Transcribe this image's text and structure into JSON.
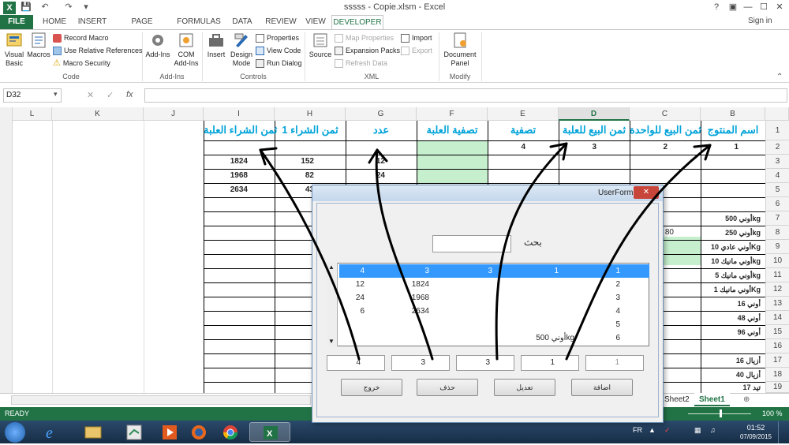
{
  "window": {
    "title": "sssss - Copie.xlsm - Excel",
    "controls": [
      "?",
      "▣",
      "—",
      "☐",
      "✕"
    ],
    "sign_in": "Sign in"
  },
  "ribbon_tabs": [
    "FILE",
    "HOME",
    "INSERT",
    "PAGE LAYOUT",
    "FORMULAS",
    "DATA",
    "REVIEW",
    "VIEW",
    "DEVELOPER"
  ],
  "ribbon": {
    "code": {
      "visual_basic": "Visual Basic",
      "macros": "Macros",
      "record_macro": "Record Macro",
      "use_relative": "Use Relative References",
      "macro_security": "Macro Security",
      "group_label": "Code"
    },
    "addins": {
      "addins": "Add-Ins",
      "com_addins": "COM Add-Ins",
      "group_label": "Add-Ins"
    },
    "controls": {
      "insert": "Insert",
      "design_mode": "Design Mode",
      "properties": "Properties",
      "view_code": "View Code",
      "run_dialog": "Run Dialog",
      "group_label": "Controls"
    },
    "xml": {
      "source": "Source",
      "map_properties": "Map Properties",
      "expansion_packs": "Expansion Packs",
      "refresh_data": "Refresh Data",
      "import": "Import",
      "export": "Export",
      "group_label": "XML"
    },
    "modify": {
      "document_panel": "Document Panel",
      "group_label": "Modify"
    }
  },
  "formula_bar": {
    "name_box": "D32",
    "fx": "fx",
    "cancel": "✕",
    "enter": "✓",
    "value": ""
  },
  "columns": [
    "L",
    "K",
    "J",
    "I",
    "H",
    "G",
    "F",
    "E",
    "D",
    "C",
    "B"
  ],
  "rows": [
    "1",
    "2",
    "3",
    "4",
    "5",
    "6",
    "7",
    "8",
    "9",
    "10",
    "11",
    "12",
    "13",
    "14",
    "15",
    "16",
    "17",
    "18",
    "19"
  ],
  "sheet": {
    "headers": {
      "B": "اسم المنتوج",
      "C": "ثمن البيع للواحدة",
      "D": "ثمن البيع للعلبة",
      "E": "تصفية",
      "F": "تصفية العلبة",
      "G": "عدد",
      "H": "ثمن الشراء 1",
      "I": "ثمن الشراء العلبة"
    },
    "row2": {
      "B": "1",
      "C": "2",
      "D": "3",
      "E": "4"
    },
    "row3": {
      "I": "1824",
      "H": "152",
      "G": "12"
    },
    "row4": {
      "I": "1968",
      "H": "82",
      "G": "24"
    },
    "row5": {
      "I": "2634",
      "H": "43"
    },
    "products": [
      "أوني 500kg",
      "أوني 250kg",
      "أوني عادي 10Kg",
      "أوني مانيك 10kg",
      "أوني مانيك 5kg",
      "أوني مانيك 1Kg",
      "أوني 16",
      "أوني 48",
      "أوني 96",
      "",
      "أزيال 16",
      "أزيال 40",
      "تيد 17"
    ],
    "c8_partial": "80"
  },
  "sheet_tabs": {
    "sheet2": "Sheet2",
    "sheet1": "Sheet1",
    "add": "⊕"
  },
  "status": {
    "ready": "READY",
    "zoom": "100 %"
  },
  "taskbar": {
    "lang": "FR",
    "time": "01:52",
    "date": "07/09/2015"
  },
  "userform": {
    "title": "UserForm1",
    "close": "✕",
    "search_label": "بحث",
    "search_value": "",
    "list_rows": [
      {
        "c1": "4",
        "c2": "3",
        "c3": "3",
        "c4": "1",
        "c5": "1",
        "selected": true
      },
      {
        "c1": "12",
        "c2": "1824",
        "c3": "",
        "c4": "",
        "c5": "2",
        "selected": false
      },
      {
        "c1": "24",
        "c2": "1968",
        "c3": "",
        "c4": "",
        "c5": "3",
        "selected": false
      },
      {
        "c1": "6",
        "c2": "2634",
        "c3": "",
        "c4": "",
        "c5": "4",
        "selected": false
      },
      {
        "c1": "",
        "c2": "",
        "c3": "",
        "c4": "",
        "c5": "5",
        "selected": false
      },
      {
        "c1": "",
        "c2": "",
        "c3": "",
        "c4": "أوني 500kg",
        "c5": "6",
        "selected": false
      }
    ],
    "textboxes": [
      "4",
      "3",
      "3",
      "1",
      "1"
    ],
    "buttons": {
      "exit": "خروج",
      "delete": "حذف",
      "edit": "تعديل",
      "add": "اضافة"
    }
  }
}
